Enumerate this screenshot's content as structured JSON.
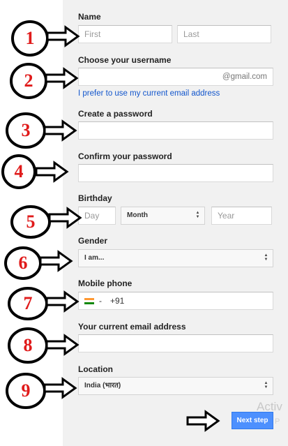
{
  "form": {
    "name_label": "Name",
    "first_placeholder": "First",
    "last_placeholder": "Last",
    "username_label": "Choose your username",
    "username_suffix": "@gmail.com",
    "current_email_link": "I prefer to use my current email address",
    "password_label": "Create a password",
    "confirm_label": "Confirm your password",
    "birthday_label": "Birthday",
    "day_placeholder": "Day",
    "month_value": "Month",
    "year_placeholder": "Year",
    "gender_label": "Gender",
    "gender_value": "I am...",
    "mobile_label": "Mobile phone",
    "country_code": "+91",
    "flag_dash": "-",
    "current_email_label": "Your current email address",
    "location_label": "Location",
    "location_value": "India (भारत)",
    "next_button": "Next step"
  },
  "annotations": [
    "1",
    "2",
    "3",
    "4",
    "5",
    "6",
    "7",
    "8",
    "9"
  ],
  "watermark": {
    "line1": "Activ",
    "line2": "Go to P"
  },
  "colors": {
    "annotation_number": "#e01b1b",
    "button": "#4d90fe",
    "link": "#1155cc"
  },
  "icons": [
    "arrow-right-icon",
    "india-flag-icon",
    "select-arrows-icon"
  ]
}
